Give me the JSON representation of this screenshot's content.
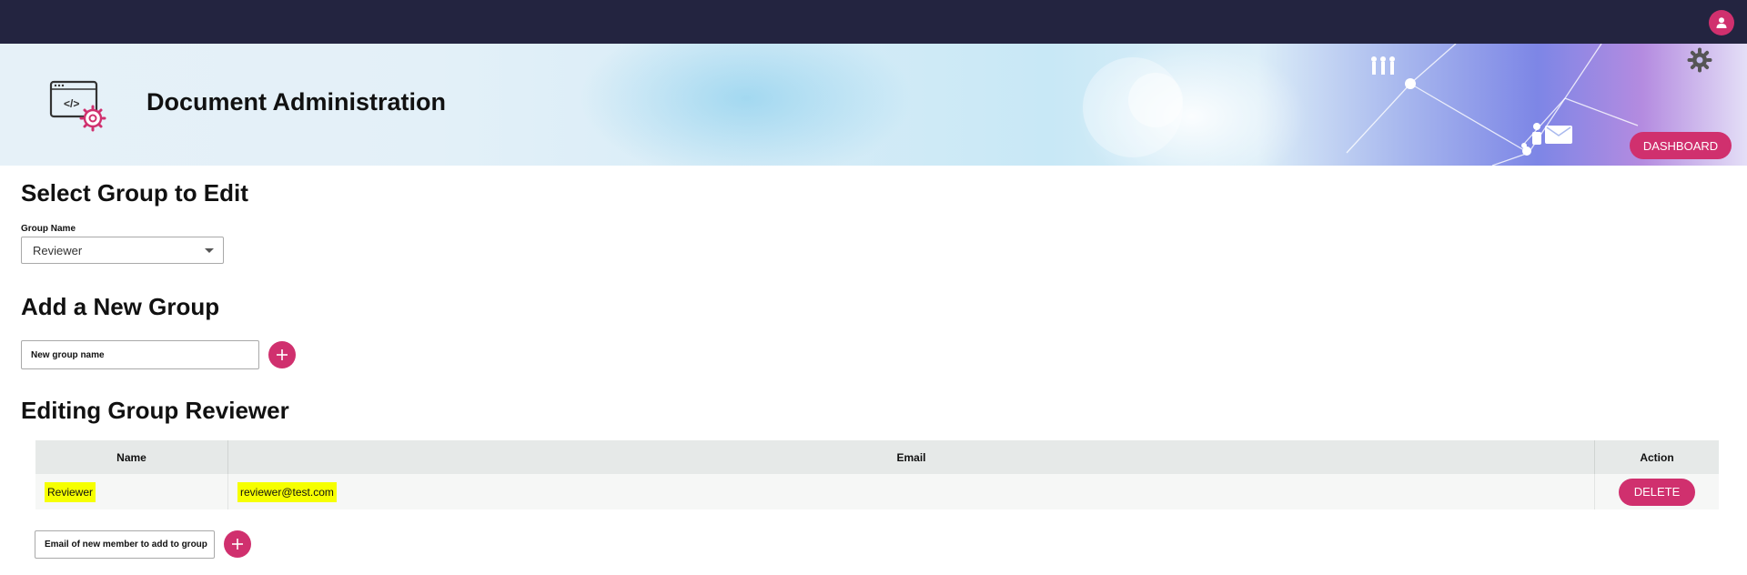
{
  "header": {
    "title": "Document Administration"
  },
  "banner": {
    "dashboard_label": "DASHBOARD",
    "logo_code_text": "</>"
  },
  "select_group": {
    "heading": "Select Group to Edit",
    "label": "Group Name",
    "selected": "Reviewer"
  },
  "add_group": {
    "heading": "Add a New Group",
    "placeholder": "New group name"
  },
  "editing": {
    "heading": "Editing Group Reviewer",
    "columns": [
      "Name",
      "Email",
      "Action"
    ],
    "rows": [
      {
        "name": "Reviewer",
        "email": "reviewer@test.com",
        "action": "DELETE"
      }
    ],
    "new_member_placeholder": "Email of new member to add to group"
  },
  "colors": {
    "topbar": "#232440",
    "accent": "#d0306e",
    "highlight": "#f6ff00"
  },
  "icons": [
    "user-icon",
    "gear-icon",
    "document-admin-logo-icon",
    "plus-icon"
  ]
}
